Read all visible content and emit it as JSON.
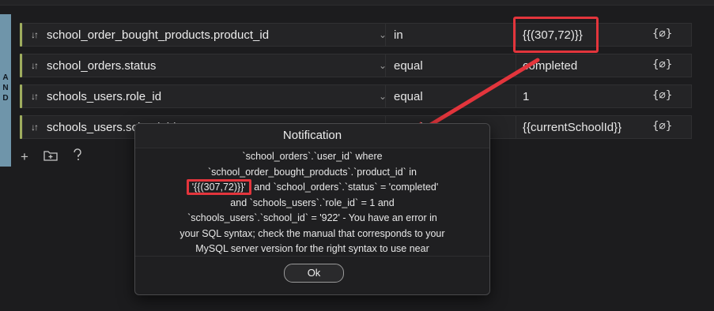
{
  "group": {
    "conjunction": "AND"
  },
  "rows": [
    {
      "field": "school_order_bought_products.product_id",
      "operator": "in",
      "value": "{{(307,72)}}",
      "fx": "{∅}"
    },
    {
      "field": "school_orders.status",
      "operator": "equal",
      "value": "completed",
      "fx": "{∅}"
    },
    {
      "field": "schools_users.role_id",
      "operator": "equal",
      "value": "1",
      "fx": "{∅}"
    },
    {
      "field": "schools_users.school_id",
      "operator": "equal",
      "value": "{{currentSchoolId}}",
      "fx": "{∅}"
    }
  ],
  "tools": {
    "add_icon": "plus-icon",
    "folder_icon": "folder-add-icon",
    "help_icon": "question-icon"
  },
  "notification": {
    "title": "Notification",
    "lines": [
      "`school_orders`.`user_id` where",
      "`school_order_bought_products`.`product_id` in",
      "'{{(307,72)}}'",
      " and `school_orders`.`status` = 'completed'",
      "and `schools_users`.`role_id` = 1 and",
      "`schools_users`.`school_id` = '922' - You have an error in",
      "your SQL syntax; check the manual that corresponds to your",
      "MySQL server version for the right syntax to use near"
    ],
    "ok_label": "Ok"
  },
  "colors": {
    "annotation_red": "#e3353c",
    "group_bar": "#6f95aa",
    "row_accent": "#9fad5e"
  }
}
